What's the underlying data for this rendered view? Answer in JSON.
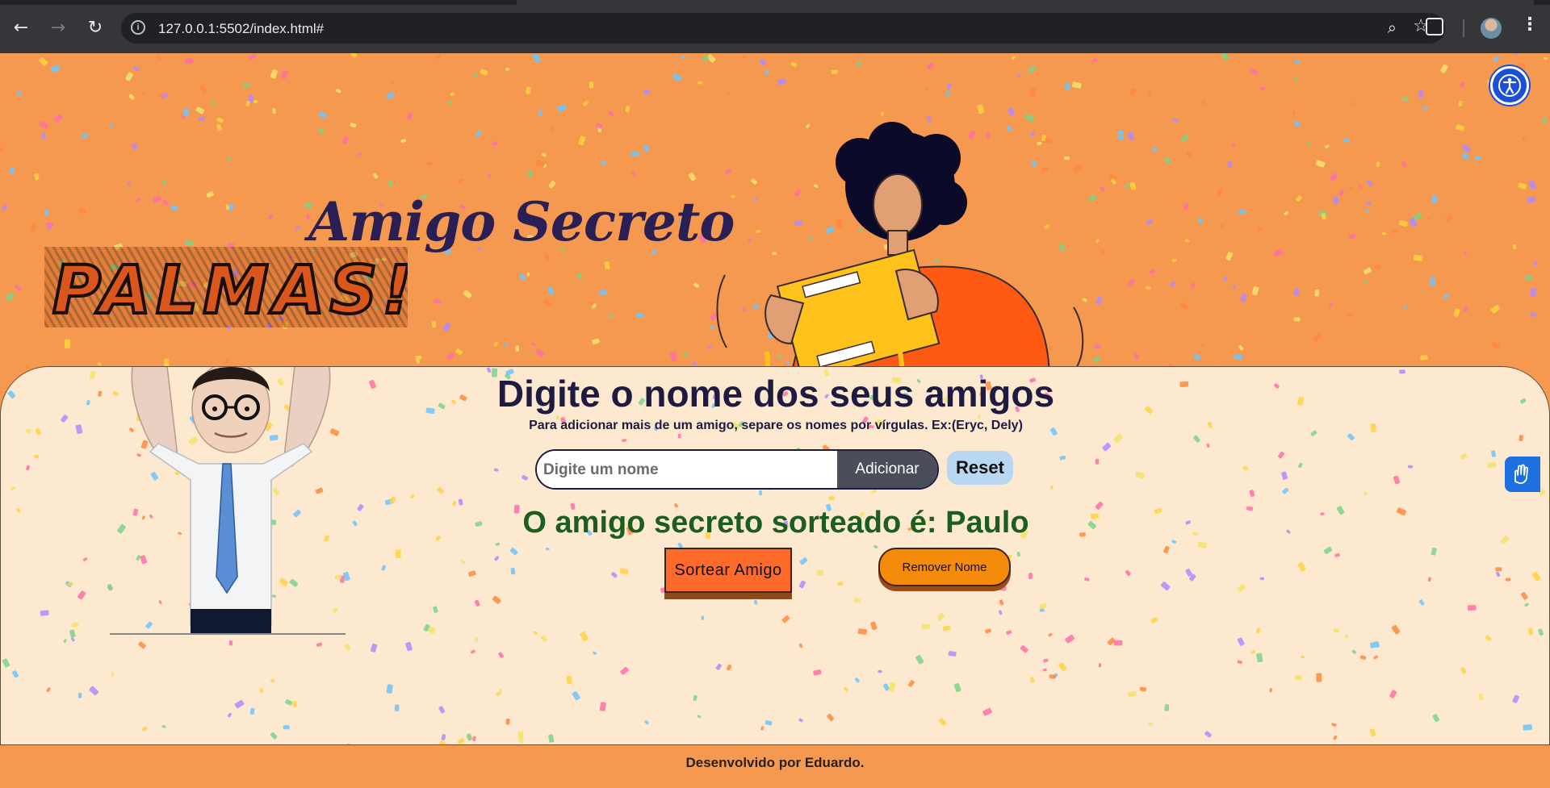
{
  "browser": {
    "url": "127.0.0.1:5502/index.html#"
  },
  "header": {
    "title": "Amigo Secreto",
    "palmas_text": "PALMAS!!"
  },
  "form": {
    "heading": "Digite o nome dos seus amigos",
    "instructions": "Para adicionar mais de um amigo, separe os nomes por vírgulas. Ex:(Eryc, Dely)",
    "input_placeholder": "Digite um nome",
    "add_label": "Adicionar",
    "reset_label": "Reset"
  },
  "result": {
    "text": "O amigo secreto sorteado é: Paulo"
  },
  "actions": {
    "draw_label": "Sortear Amigo",
    "remove_label": "Remover Nome"
  },
  "footer": {
    "text": "Desenvolvido por Eduardo."
  },
  "colors": {
    "page_bg": "#f4994f",
    "panel_bg": "#fde9cf",
    "title": "#2a1f55",
    "result": "#1b5e20",
    "draw_button": "#fe6a2a",
    "remove_button": "#f48b0a",
    "add_button": "#4a4e5a",
    "reset_button": "#b9d6f2"
  },
  "icons": {
    "back": "arrow-left-icon",
    "forward": "arrow-right-icon",
    "reload": "reload-icon",
    "site_info": "info-icon",
    "zoom": "zoom-icon",
    "bookmark": "star-icon",
    "extensions": "puzzle-icon",
    "menu": "kebab-menu-icon",
    "accessibility": "accessibility-icon",
    "sign_language": "hands-icon"
  }
}
